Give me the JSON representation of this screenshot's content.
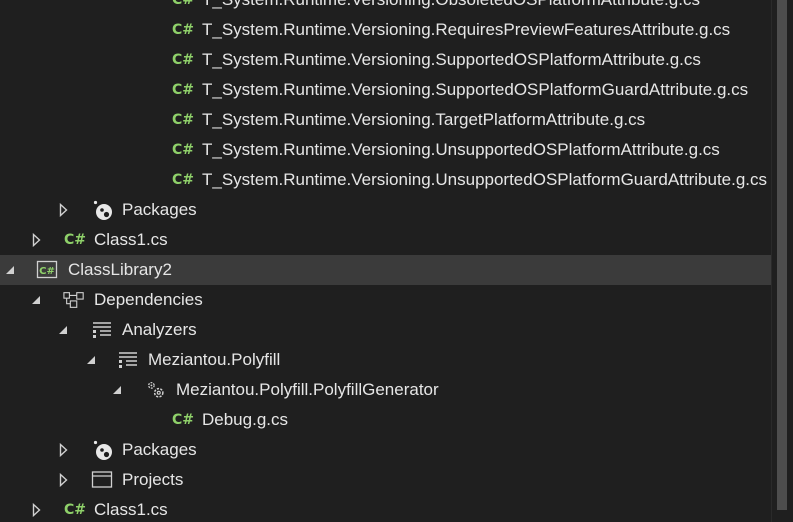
{
  "tree": {
    "rows": [
      {
        "label": "T_System.Runtime.Versioning.ObsoletedOSPlatformAttribute.g.cs",
        "icon": "csharp-file-icon"
      },
      {
        "label": "T_System.Runtime.Versioning.RequiresPreviewFeaturesAttribute.g.cs",
        "icon": "csharp-file-icon"
      },
      {
        "label": "T_System.Runtime.Versioning.SupportedOSPlatformAttribute.g.cs",
        "icon": "csharp-file-icon"
      },
      {
        "label": "T_System.Runtime.Versioning.SupportedOSPlatformGuardAttribute.g.cs",
        "icon": "csharp-file-icon"
      },
      {
        "label": "T_System.Runtime.Versioning.TargetPlatformAttribute.g.cs",
        "icon": "csharp-file-icon"
      },
      {
        "label": "T_System.Runtime.Versioning.UnsupportedOSPlatformAttribute.g.cs",
        "icon": "csharp-file-icon"
      },
      {
        "label": "T_System.Runtime.Versioning.UnsupportedOSPlatformGuardAttribute.g.cs",
        "icon": "csharp-file-icon"
      },
      {
        "label": "Packages",
        "icon": "packages-icon"
      },
      {
        "label": "Class1.cs",
        "icon": "csharp-file-icon"
      },
      {
        "label": "ClassLibrary2",
        "icon": "csharp-project-icon"
      },
      {
        "label": "Dependencies",
        "icon": "dependencies-icon"
      },
      {
        "label": "Analyzers",
        "icon": "analyzers-icon"
      },
      {
        "label": "Meziantou.Polyfill",
        "icon": "analyzer-icon"
      },
      {
        "label": "Meziantou.Polyfill.PolyfillGenerator",
        "icon": "generator-icon"
      },
      {
        "label": "Debug.g.cs",
        "icon": "csharp-file-icon"
      },
      {
        "label": "Packages",
        "icon": "packages-icon"
      },
      {
        "label": "Projects",
        "icon": "projects-icon"
      },
      {
        "label": "Class1.cs",
        "icon": "csharp-file-icon"
      }
    ]
  },
  "icons": {
    "csharp_glyph": "C#"
  },
  "colors": {
    "background": "#1f1f1f",
    "selected_row": "#3b3b3b",
    "text": "#e6e6e6",
    "csharp_green": "#8fd16a"
  }
}
